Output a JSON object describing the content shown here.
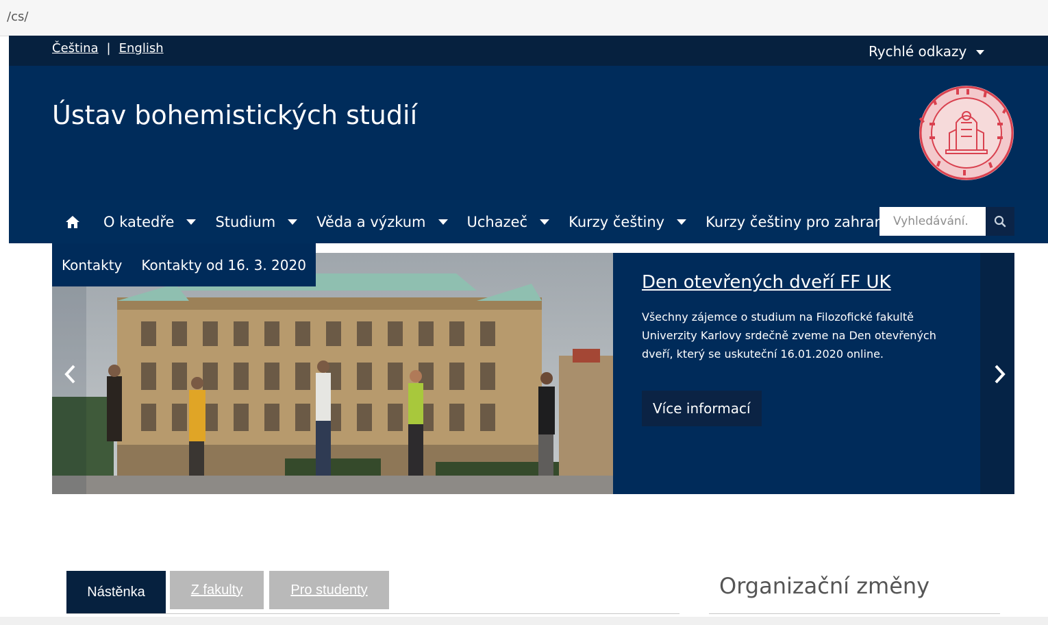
{
  "browser": {
    "url": "/cs/"
  },
  "topbar": {
    "lang_cs": "Čeština",
    "separator": "|",
    "lang_en": "English",
    "quick_links": "Rychlé odkazy"
  },
  "header": {
    "title": "Ústav bohemistických studií"
  },
  "nav": {
    "items": [
      {
        "label": "O katedře"
      },
      {
        "label": "Studium"
      },
      {
        "label": "Věda a výzkum"
      },
      {
        "label": "Uchazeč"
      },
      {
        "label": "Kurzy češtiny"
      },
      {
        "label": "Kurzy češtiny pro zahraniční studenty"
      }
    ],
    "search_placeholder": "Vyhledávání."
  },
  "subnav": {
    "items": [
      "Kontakty",
      "Kontakty od 16. 3. 2020"
    ]
  },
  "carousel": {
    "title": "Den otevřených dveří FF UK",
    "description": "Všechny zájemce o studium na Filozofické fakultě Univerzity Karlovy srdečně zveme na Den otevřených dveří, který se uskuteční 16.01.2020 online.",
    "button": "Více informací"
  },
  "tabs": {
    "items": [
      "Nástěnka",
      "Z fakulty",
      "Pro studenty"
    ]
  },
  "sidebar": {
    "title": "Organizační změny"
  },
  "colors": {
    "navy": "#002c5b",
    "dark_navy": "#06213f",
    "tab_inactive": "#b9b9b9",
    "seal_red": "#d9414f"
  }
}
